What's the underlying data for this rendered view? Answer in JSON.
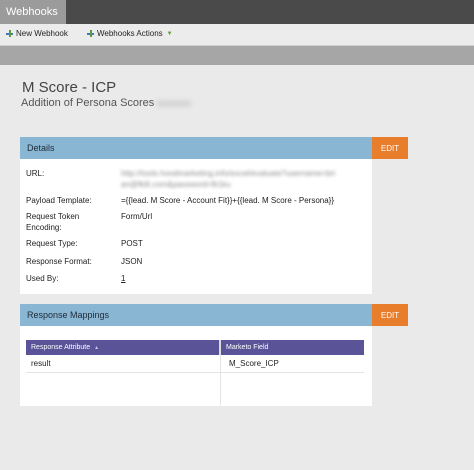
{
  "tab": {
    "label": "Webhooks"
  },
  "toolbar": {
    "new_label": "New Webhook",
    "actions_label": "Webhooks Actions",
    "new_icon": "add-plus-icon",
    "actions_icon": "actions-plus-icon"
  },
  "header": {
    "title": "M Score - ICP",
    "subtitle": "Addition of  Persona Scores"
  },
  "details": {
    "heading": "Details",
    "edit_label": "EDIT",
    "rows": [
      {
        "label": "URL:",
        "value_line1": "http://tools.hoodmarketing.info/excel/evaluate?username=bri",
        "value_line2": "an@fkilt.com&password=fk1ku"
      },
      {
        "label": "Payload Template:",
        "value": "={{lead.  M Score - Account Fit}}+{{lead.  M Score - Persona}}"
      },
      {
        "label_line1": "Request Token",
        "label_line2": "Encoding:",
        "value": "Form/Url"
      },
      {
        "label": "Request Type:",
        "value": "POST"
      },
      {
        "label": "Response Format:",
        "value": "JSON"
      },
      {
        "label": "Used By:",
        "value": "1"
      }
    ]
  },
  "mappings": {
    "heading": "Response Mappings",
    "edit_label": "EDIT",
    "columns": [
      "Response Attribute",
      "Marketo Field"
    ],
    "sort_indicator": "▲",
    "rows": [
      {
        "attribute": "result",
        "field": "M_Score_ICP"
      }
    ]
  },
  "colors": {
    "panel_header": "#89b6d3",
    "edit_button": "#e87d2c",
    "table_header": "#5a5398",
    "tab_bar": "#4a4a4a"
  }
}
